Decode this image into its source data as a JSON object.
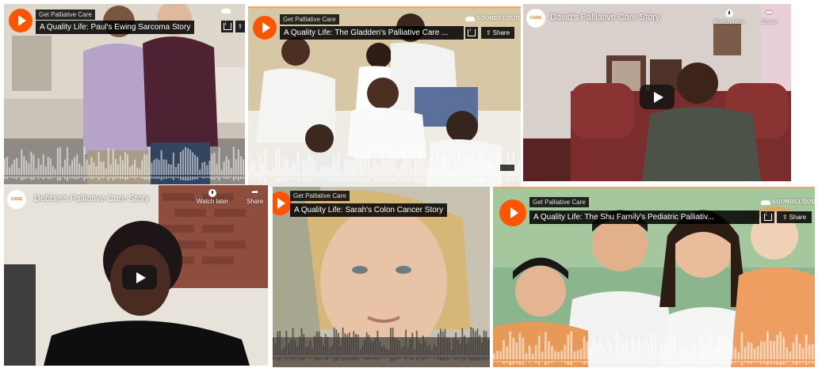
{
  "common": {
    "sc_user": "Get Palliative Care",
    "sc_brand": "SOUNDCLOUD",
    "share_label": "Share",
    "watch_later": "Watch later",
    "yt_share": "Share",
    "channel_logo": "CARE",
    "accent": "#ff5500"
  },
  "tiles": [
    {
      "kind": "soundcloud",
      "title": "A Quality Life: Paul's Ewing Sarcoma Story"
    },
    {
      "kind": "soundcloud",
      "title": "A Quality Life: The Gladden's Palliative Care ..."
    },
    {
      "kind": "youtube",
      "title": "David's Palliative Care Story"
    },
    {
      "kind": "youtube",
      "title": "Debbie's Palliative Care Story"
    },
    {
      "kind": "soundcloud",
      "title": "A Quality Life: Sarah's Colon Cancer Story"
    },
    {
      "kind": "soundcloud",
      "title": "A Quality Life: The Shu Family's Pediatric Palliativ..."
    }
  ]
}
